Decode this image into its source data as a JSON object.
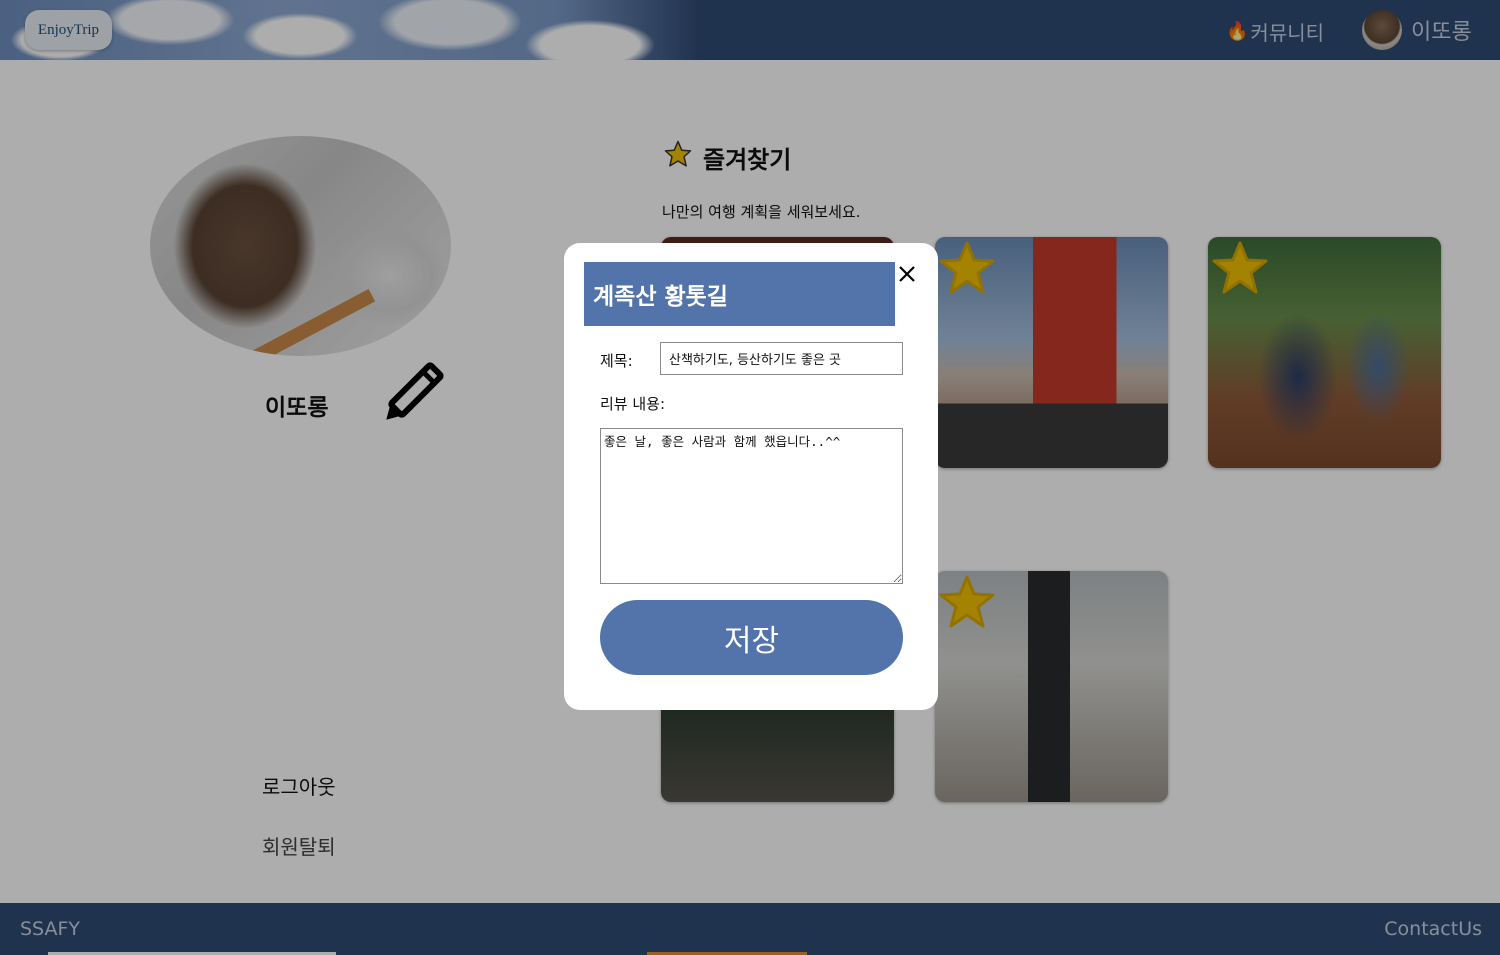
{
  "header": {
    "logo_text": "EnjoyTrip",
    "community_label": "커뮤니티",
    "user_name": "이또롱"
  },
  "profile": {
    "name": "이또롱",
    "logout_label": "로그아웃",
    "withdraw_label": "회원탈퇴"
  },
  "favorites": {
    "title": "즐겨찾기",
    "subtitle": "나만의 여행 계획을 세워보세요."
  },
  "modal": {
    "place_title": "계족산 황톳길",
    "title_label": "제목:",
    "title_value": "산책하기도, 등산하기도 좋은 곳",
    "review_label": "리뷰 내용:",
    "review_value": "좋은 날, 좋은 사람과 함께 했읍니다..^^",
    "save_label": "저장"
  },
  "footer": {
    "left_text": "SSAFY",
    "right_text": "ContactUs"
  },
  "colors": {
    "brand": "#2f4a73",
    "accent": "#5274aa",
    "star": "#f2c200"
  }
}
